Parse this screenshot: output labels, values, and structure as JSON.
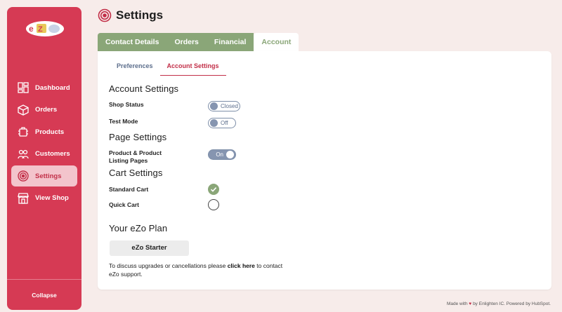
{
  "app": {
    "logo_text": "eZo"
  },
  "sidebar": {
    "items": [
      {
        "label": "Dashboard",
        "icon": "dashboard-icon"
      },
      {
        "label": "Orders",
        "icon": "orders-box-icon"
      },
      {
        "label": "Products",
        "icon": "products-icon"
      },
      {
        "label": "Customers",
        "icon": "customers-icon"
      },
      {
        "label": "Settings",
        "icon": "settings-target-icon",
        "active": true
      },
      {
        "label": "View Shop",
        "icon": "storefront-icon"
      }
    ],
    "collapse_label": "Collapse"
  },
  "header": {
    "title": "Settings",
    "icon": "settings-target-icon"
  },
  "tabs": [
    {
      "label": "Contact Details"
    },
    {
      "label": "Orders"
    },
    {
      "label": "Financial"
    },
    {
      "label": "Account",
      "active": true
    }
  ],
  "subtabs": [
    {
      "label": "Preferences"
    },
    {
      "label": "Account Settings",
      "active": true
    }
  ],
  "sections": {
    "account": {
      "heading": "Account Settings",
      "shop_status": {
        "label": "Shop Status",
        "toggle_text": "Closed",
        "on": false
      },
      "test_mode": {
        "label": "Test Mode",
        "toggle_text": "Off",
        "on": false
      }
    },
    "page": {
      "heading": "Page Settings",
      "product_listing": {
        "label_line1": "Product & Product",
        "label_line2": "Listing Pages",
        "toggle_text": "On",
        "on": true
      }
    },
    "cart": {
      "heading": "Cart Settings",
      "standard": {
        "label": "Standard Cart",
        "checked": true
      },
      "quick": {
        "label": "Quick Cart",
        "checked": false
      }
    },
    "plan": {
      "heading": "Your eZo Plan",
      "badge": "eZo Starter",
      "note_prefix": "To discuss upgrades or cancellations please ",
      "note_link": "click here",
      "note_suffix": " to contact eZo support."
    }
  },
  "footer": {
    "made_with": "Made with",
    "by": "by Enlighten IC. Powered by HubSpot."
  },
  "colors": {
    "sidebar": "#d63a54",
    "accent_green": "#8aa678",
    "accent_red": "#c22f48",
    "toggle_blue": "#8695b0",
    "background": "#f7ecea"
  }
}
